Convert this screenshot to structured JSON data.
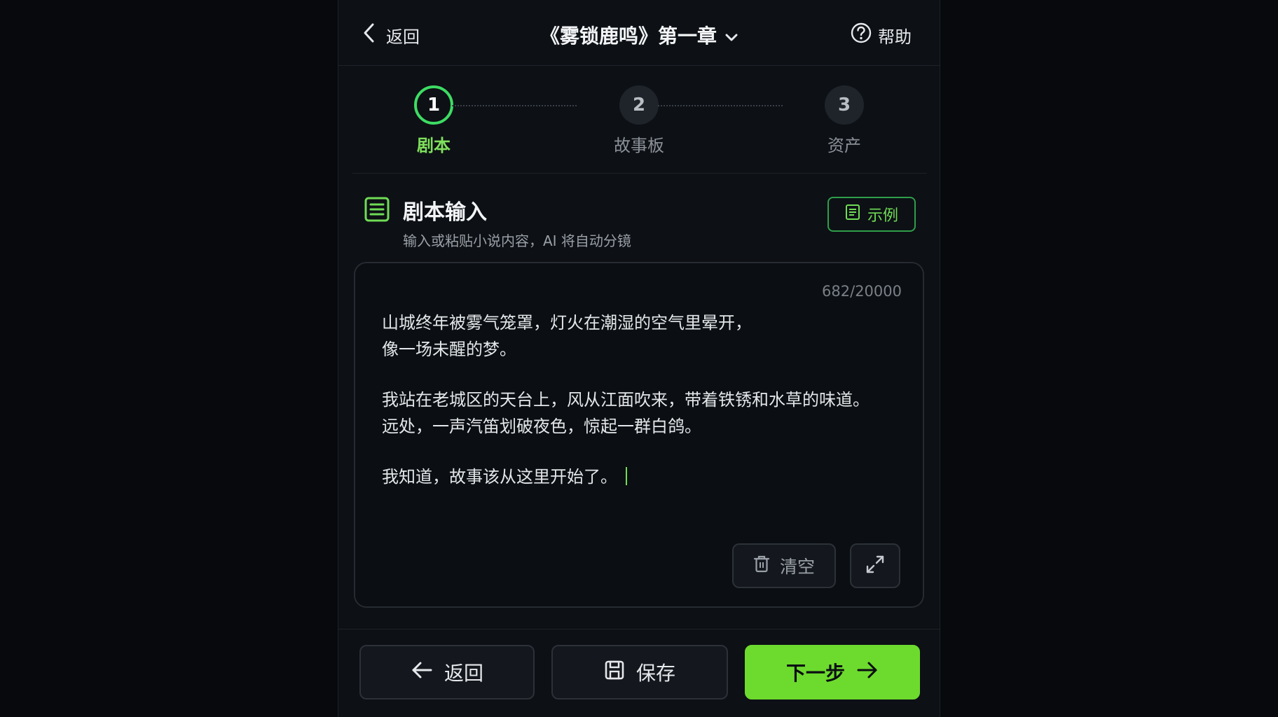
{
  "colors": {
    "accent": "#3ddc63",
    "accent_text": "#6fdc55",
    "primary_button": "#6ddb2e",
    "background": "#0d1015"
  },
  "header": {
    "back_label": "返回",
    "back_icon": "chevron-left-icon",
    "title": "《雾锁鹿鸣》第一章",
    "title_icon": "chevron-down-icon",
    "help_label": "帮助",
    "help_icon": "question-circle-icon"
  },
  "stepper": {
    "current": 1,
    "steps": [
      {
        "number": "1",
        "label": "剧本"
      },
      {
        "number": "2",
        "label": "故事板"
      },
      {
        "number": "3",
        "label": "资产"
      }
    ]
  },
  "section": {
    "icon": "document-list-icon",
    "title": "剧本输入",
    "subtitle": "输入或粘贴小说内容，AI 将自动分镜",
    "example_label": "示例",
    "example_icon": "document-icon"
  },
  "editor": {
    "char_count": "682/20000",
    "lines": [
      "山城终年被雾气笼罩，灯火在潮湿的空气里晕开，",
      "像一场未醒的梦。",
      "",
      "我站在老城区的天台上，风从江面吹来，带着铁锈和水草的味道。",
      "远处，一声汽笛划破夜色，惊起一群白鸽。",
      "",
      "我知道，故事该从这里开始了。"
    ],
    "clear_label": "清空",
    "clear_icon": "trash-icon",
    "expand_icon": "expand-icon"
  },
  "footer": {
    "back_label": "返回",
    "back_icon": "arrow-left-icon",
    "save_label": "保存",
    "save_icon": "save-icon",
    "next_label": "下一步",
    "next_icon": "arrow-right-icon"
  }
}
